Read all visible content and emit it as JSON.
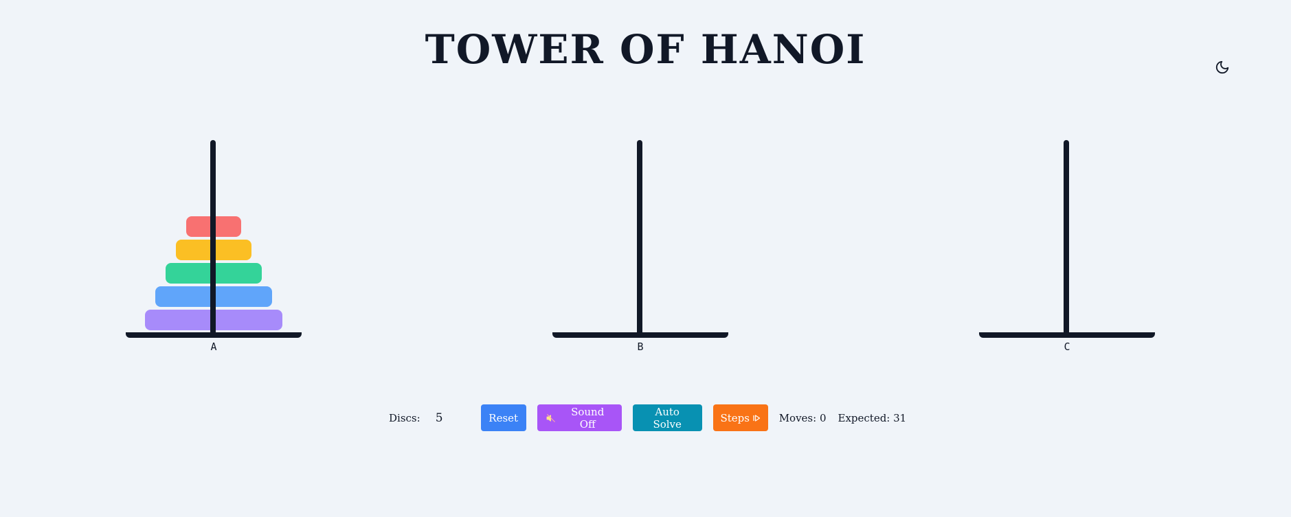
{
  "header": {
    "title": "TOWER OF HANOI",
    "theme_icon": "moon-icon"
  },
  "game": {
    "pegs": [
      {
        "label": "A",
        "discs": [
          1,
          2,
          3,
          4,
          5
        ]
      },
      {
        "label": "B",
        "discs": []
      },
      {
        "label": "C",
        "discs": []
      }
    ],
    "disc_colors": [
      "#f87171",
      "#fbbf24",
      "#34d399",
      "#60a5fa",
      "#a78bfa"
    ],
    "rod_color": "#111827"
  },
  "controls": {
    "discs_label": "Discs:",
    "discs_value": "5",
    "reset_label": "Reset",
    "sound_label": "Sound Off",
    "sound_icon": "speaker-muted-icon",
    "auto_solve_label": "Auto Solve",
    "steps_label": "Steps",
    "steps_icon": "step-forward-icon",
    "moves_text": "Moves: 0",
    "expected_text": "Expected: 31"
  },
  "colors": {
    "background": "#f0f4f9",
    "reset": "#3b82f6",
    "sound": "#a855f7",
    "auto_solve": "#0891b2",
    "steps": "#f97316"
  }
}
